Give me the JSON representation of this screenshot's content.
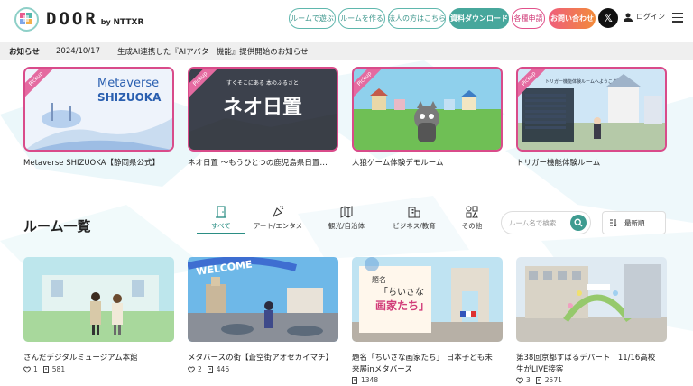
{
  "header": {
    "logo_text": "DOOR",
    "logo_sub_by": "by",
    "logo_sub_brand": "NTTXR",
    "nav": [
      {
        "label": "ルームで遊ぶ",
        "style": "outline"
      },
      {
        "label": "ルームを作る",
        "style": "outline"
      },
      {
        "label": "法人の方はこちら",
        "style": "outline"
      },
      {
        "label": "資料ダウンロード",
        "style": "fill-teal"
      },
      {
        "label": "各種申請",
        "style": "outline-pink"
      },
      {
        "label": "お問い合わせ",
        "style": "fill-orange"
      }
    ],
    "x_icon": "𝕏",
    "login_label": "ログイン"
  },
  "notice": {
    "label": "お知らせ",
    "date": "2024/10/17",
    "text": "生成AI連携した『AIアバター機能』提供開始のお知らせ"
  },
  "pickup": {
    "tag": "Pickup",
    "cards": [
      {
        "title": "Metaverse SHIZUOKA【静岡県公式】",
        "thumb_text_1": "Metaverse",
        "thumb_text_2": "SHIZUOKA"
      },
      {
        "title": "ネオ日置 ～もうひとつの鹿児島県日置…",
        "thumb_text_1": "ネオ日置",
        "thumb_text_2": "すぐそこにある 本のふるさと"
      },
      {
        "title": "人狼ゲーム体験デモルーム"
      },
      {
        "title": "トリガー機能体験ルーム",
        "thumb_text_1": "トリガー機能体験ルームへようこそ"
      }
    ]
  },
  "rooms_section": {
    "title": "ルーム一覧",
    "categories": [
      {
        "label": "すべて",
        "icon": "door-icon",
        "active": true
      },
      {
        "label": "アート/エンタメ",
        "icon": "party-popper-icon",
        "active": false
      },
      {
        "label": "観光/自治体",
        "icon": "map-icon",
        "active": false
      },
      {
        "label": "ビジネス/教育",
        "icon": "building-icon",
        "active": false
      },
      {
        "label": "その他",
        "icon": "grid-icon",
        "active": false
      }
    ],
    "search_placeholder": "ルーム名で検索",
    "sort_label": "最新順"
  },
  "rooms": [
    {
      "title": "さんだデジタルミュージアム本館",
      "likes": "1",
      "views": "581"
    },
    {
      "title": "メタバースの街【蒼空街アオセカイマチ】",
      "likes": "2",
      "views": "446",
      "thumb_text": "WELCOME"
    },
    {
      "title_1": "題名「ちいさな画家たち」 日本子ども未",
      "title_2": "来展inメタバース",
      "views": "1348",
      "thumb_text_1": "題名",
      "thumb_text_2": "「ちいさな",
      "thumb_text_3": "画家たち」"
    },
    {
      "title_1": "第38回京都すばるデパート　11/16高校",
      "title_2": "生がLIVE接客",
      "likes": "3",
      "views": "2571"
    }
  ],
  "colors": {
    "teal": "#47a79c",
    "pink": "#d94b8a",
    "orange": "#f28b3a"
  }
}
